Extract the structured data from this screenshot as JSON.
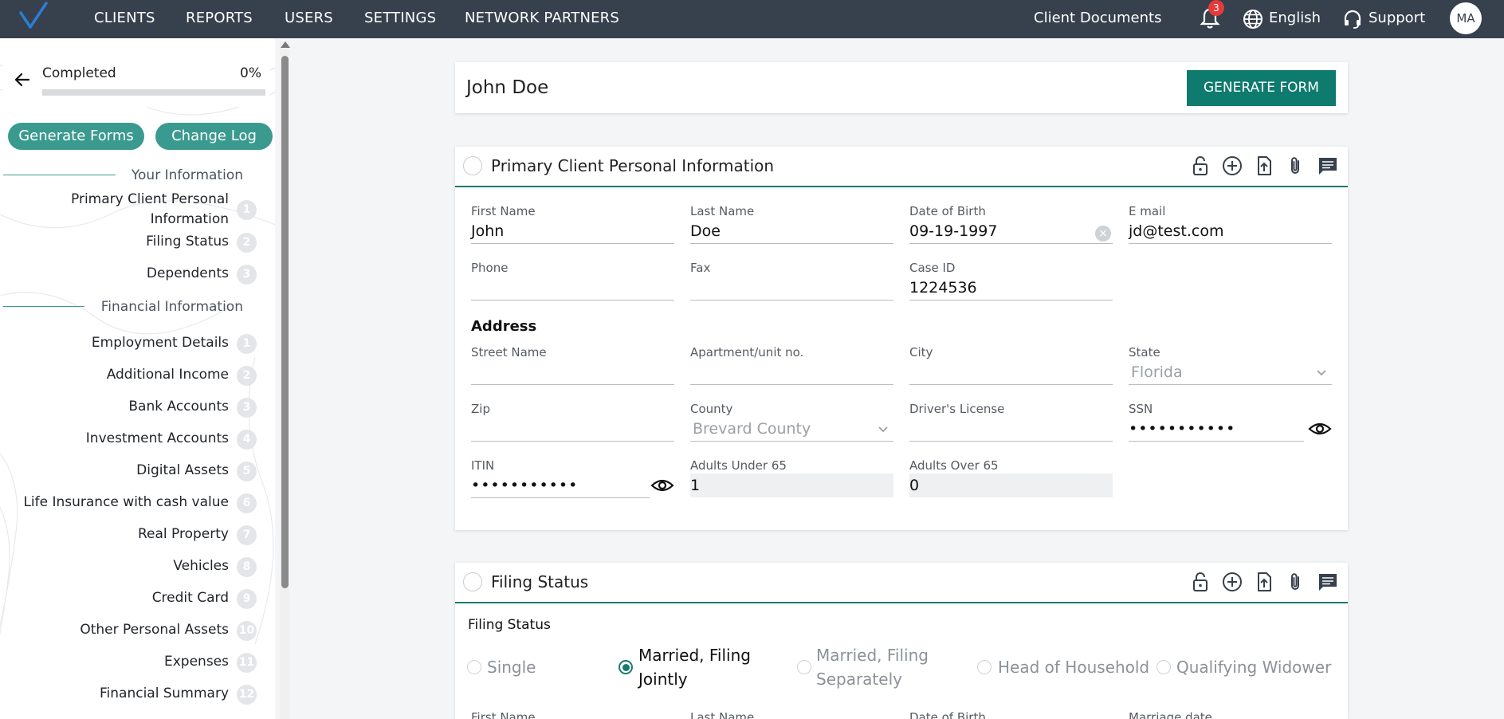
{
  "topbar": {
    "nav": [
      "CLIENTS",
      "REPORTS",
      "USERS",
      "SETTINGS",
      "NETWORK PARTNERS"
    ],
    "client_documents": "Client Documents",
    "notification_count": "3",
    "language": "English",
    "support": "Support",
    "avatar_initials": "MA"
  },
  "sidebar": {
    "progress_label": "Completed",
    "progress_pct": "0%",
    "progress_value": 0,
    "generate_forms": "Generate Forms",
    "change_log": "Change Log",
    "your_info_heading": "Your Information",
    "your_info_items": [
      {
        "label": "Primary Client Personal Information",
        "num": "1"
      },
      {
        "label": "Filing Status",
        "num": "2"
      },
      {
        "label": "Dependents",
        "num": "3"
      }
    ],
    "financial_heading": "Financial Information",
    "financial_items": [
      {
        "label": "Employment Details",
        "num": "1"
      },
      {
        "label": "Additional Income",
        "num": "2"
      },
      {
        "label": "Bank Accounts",
        "num": "3"
      },
      {
        "label": "Investment Accounts",
        "num": "4"
      },
      {
        "label": "Digital Assets",
        "num": "5"
      },
      {
        "label": "Life Insurance with cash value",
        "num": "6"
      },
      {
        "label": "Real Property",
        "num": "7"
      },
      {
        "label": "Vehicles",
        "num": "8"
      },
      {
        "label": "Credit Card",
        "num": "9"
      },
      {
        "label": "Other Personal Assets",
        "num": "10"
      },
      {
        "label": "Expenses",
        "num": "11"
      },
      {
        "label": "Financial Summary",
        "num": "12"
      }
    ]
  },
  "main": {
    "client_name": "John Doe",
    "generate_form": "GENERATE FORM",
    "primary": {
      "title": "Primary Client Personal Information",
      "first_name_label": "First Name",
      "first_name": "John",
      "last_name_label": "Last Name",
      "last_name": "Doe",
      "dob_label": "Date of Birth",
      "dob": "09-19-1997",
      "email_label": "E mail",
      "email": "jd@test.com",
      "phone_label": "Phone",
      "fax_label": "Fax",
      "case_id_label": "Case ID",
      "case_id": "1224536",
      "address_title": "Address",
      "street_label": "Street Name",
      "apt_label": "Apartment/unit no.",
      "city_label": "City",
      "state_label": "State",
      "state_value": "Florida",
      "zip_label": "Zip",
      "county_label": "County",
      "county_value": "Brevard County",
      "dl_label": "Driver's License",
      "ssn_label": "SSN",
      "ssn_value": "•••••••••••",
      "itin_label": "ITIN",
      "itin_value": "•••••••••••",
      "adults_under_label": "Adults Under 65",
      "adults_under": "1",
      "adults_over_label": "Adults Over 65",
      "adults_over": "0"
    },
    "filing": {
      "title": "Filing Status",
      "field_label": "Filing Status",
      "options": [
        "Single",
        "Married, Filing Jointly",
        "Married, Filing Separately",
        "Head of Household",
        "Qualifying Widower"
      ],
      "selected": "Married, Filing Jointly",
      "next_labels": [
        "First Name",
        "Last Name",
        "Date of Birth",
        "Marriage date"
      ]
    }
  },
  "colors": {
    "topbar": "#37404d",
    "accent": "#0f7a6e",
    "pill": "#3a9a8f"
  }
}
